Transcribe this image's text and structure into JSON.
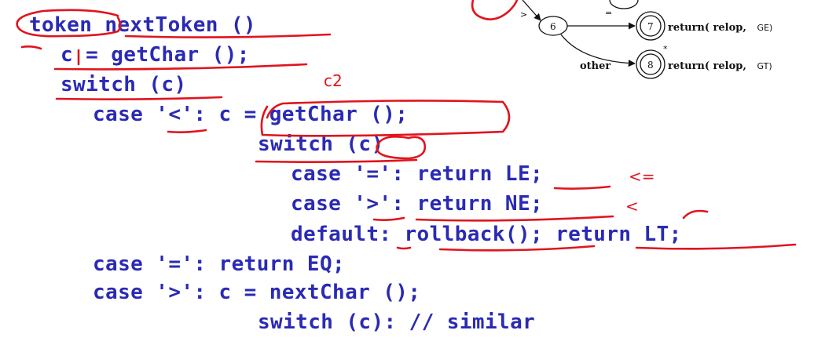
{
  "code": {
    "lines": [
      "token nextToken ()",
      "c = getChar ();",
      "switch (c)",
      "case '<': c = getChar ();",
      "switch (c)",
      "case '=': return LE;",
      "case '>': return NE;",
      "default: rollback(); return LT;",
      "case '=': return EQ;",
      "case '>': c = nextChar ();",
      "switch (c): // similar"
    ]
  },
  "diagram": {
    "edge_labels": [
      ">",
      "=",
      "other"
    ],
    "states": [
      "6",
      "7",
      "8"
    ],
    "returns": [
      {
        "text": "return( relop,",
        "arg": "GE)"
      },
      {
        "text": "return( relop,",
        "arg": "GT)"
      }
    ],
    "retract_mark": "*"
  },
  "annotations": {
    "handwritten": [
      "c2",
      "<=",
      "<"
    ]
  },
  "colors": {
    "code": "#2a2ab4",
    "ink": "#e0141e"
  }
}
